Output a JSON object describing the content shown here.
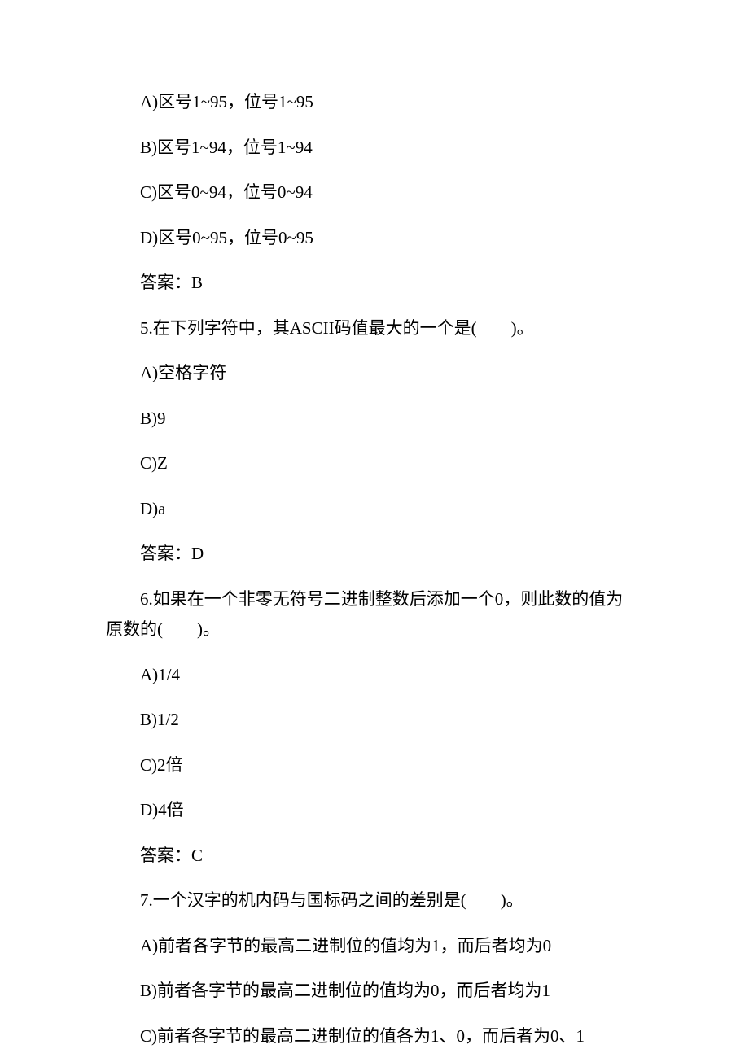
{
  "lines": [
    "A)区号1~95，位号1~95",
    "B)区号1~94，位号1~94",
    "C)区号0~94，位号0~94",
    "D)区号0~95，位号0~95",
    "答案：B",
    "5.在下列字符中，其ASCII码值最大的一个是(　　)。",
    "A)空格字符",
    "B)9",
    "C)Z",
    "D)a",
    "答案：D",
    "6.如果在一个非零无符号二进制整数后添加一个0，则此数的值为",
    "A)1/4",
    "B)1/2",
    "C)2倍",
    "D)4倍",
    "答案：C",
    "7.一个汉字的机内码与国标码之间的差别是(　　)。",
    "A)前者各字节的最高二进制位的值均为1，而后者均为0",
    "B)前者各字节的最高二进制位的值均为0，而后者均为1",
    "C)前者各字节的最高二进制位的值各为1、0，而后者为0、1"
  ],
  "continuation": "原数的(　　)。"
}
